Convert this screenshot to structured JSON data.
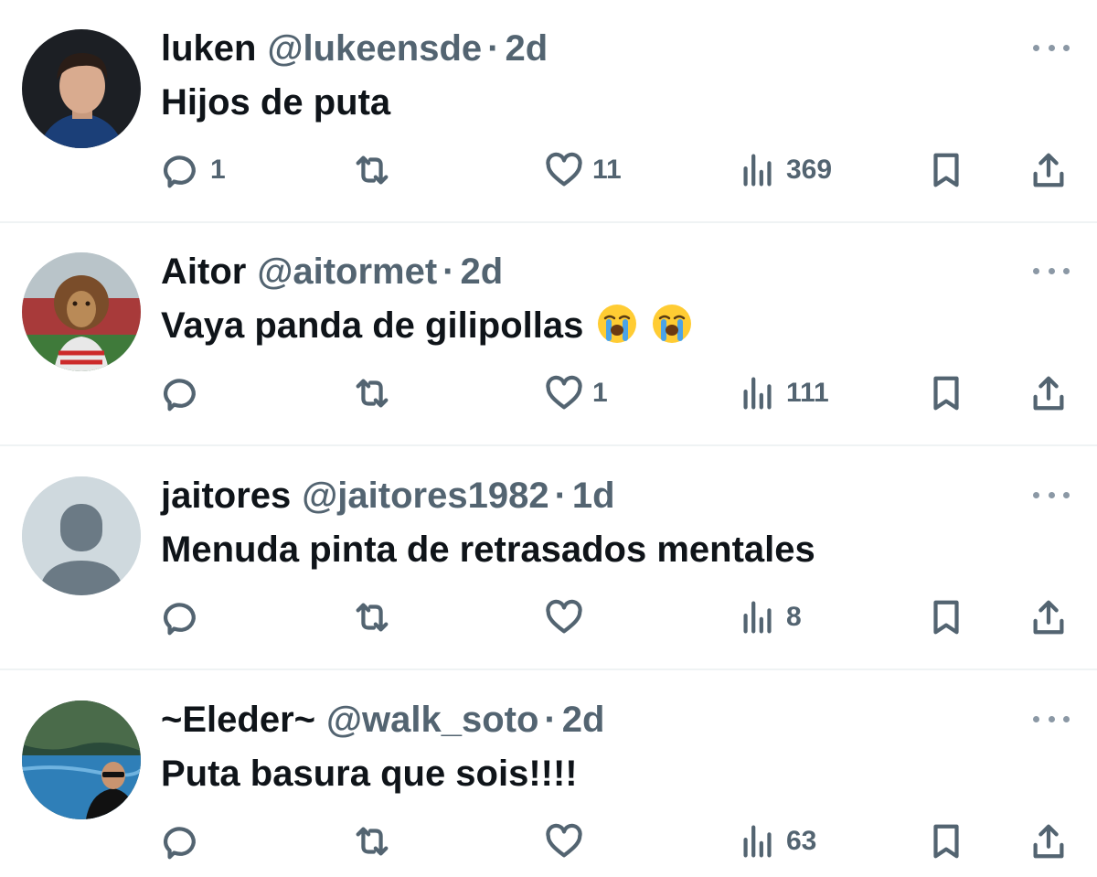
{
  "colors": {
    "text": "#0f1419",
    "secondary": "#536471",
    "divider": "#eff3f4"
  },
  "tweets": [
    {
      "name": "luken",
      "handle": "@lukeensde",
      "separator": "·",
      "time": "2d",
      "text": "Hijos de puta",
      "emojis": [],
      "avatar": "profile-photo",
      "stats": {
        "replies": "1",
        "retweets": "",
        "likes": "11",
        "views": "369"
      }
    },
    {
      "name": "Aitor",
      "handle": "@aitormet",
      "separator": "·",
      "time": "2d",
      "text": "Vaya panda de gilipollas",
      "emojis": [
        "loudly-crying-face",
        "loudly-crying-face"
      ],
      "avatar": "lion-photo",
      "stats": {
        "replies": "",
        "retweets": "",
        "likes": "1",
        "views": "111"
      }
    },
    {
      "name": "jaitores",
      "handle": "@jaitores1982",
      "separator": "·",
      "time": "1d",
      "text": "Menuda pinta de retrasados mentales",
      "emojis": [],
      "avatar": "default-avatar",
      "stats": {
        "replies": "",
        "retweets": "",
        "likes": "",
        "views": "8"
      }
    },
    {
      "name": "~Eleder~",
      "handle": "@walk_soto",
      "separator": "·",
      "time": "2d",
      "text": "Puta basura que sois!!!!",
      "emojis": [],
      "avatar": "boat-photo",
      "stats": {
        "replies": "",
        "retweets": "",
        "likes": "",
        "views": "63"
      }
    }
  ]
}
